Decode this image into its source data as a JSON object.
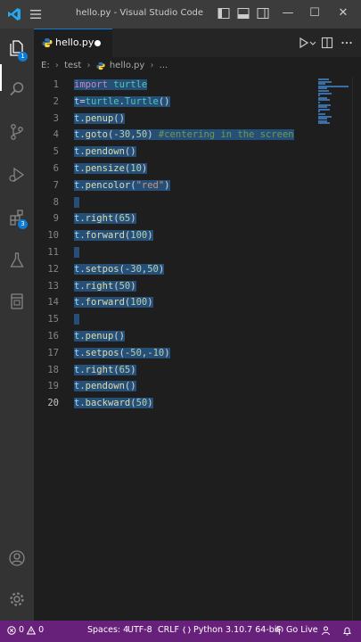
{
  "window": {
    "title": "hello.py - Visual Studio Code",
    "minimize": "—",
    "maximize": "☐",
    "close": "✕"
  },
  "activity": {
    "explorer_badge": "1",
    "extensions_badge": "3"
  },
  "tab": {
    "label": "hello.py"
  },
  "breadcrumb": {
    "drive": "E:",
    "folder": "test",
    "file": "hello.py",
    "more": "..."
  },
  "editor": {
    "active_line": 20,
    "lines": [
      {
        "n": "1",
        "tokens": [
          [
            "k-import",
            "import"
          ],
          [
            "k-pl",
            " "
          ],
          [
            "k-cls",
            "turtle"
          ]
        ]
      },
      {
        "n": "2",
        "tokens": [
          [
            "k-var",
            "t"
          ],
          [
            "k-pl",
            "="
          ],
          [
            "k-cls",
            "turtle"
          ],
          [
            "k-pl",
            "."
          ],
          [
            "k-cls",
            "Turtle"
          ],
          [
            "k-pl",
            "()"
          ]
        ]
      },
      {
        "n": "3",
        "tokens": [
          [
            "k-var",
            "t"
          ],
          [
            "k-pl",
            "."
          ],
          [
            "k-fn",
            "penup"
          ],
          [
            "k-pl",
            "()"
          ]
        ]
      },
      {
        "n": "4",
        "tokens": [
          [
            "k-var",
            "t"
          ],
          [
            "k-pl",
            "."
          ],
          [
            "k-fn",
            "goto"
          ],
          [
            "k-pl",
            "(-"
          ],
          [
            "k-num",
            "30"
          ],
          [
            "k-pl",
            ","
          ],
          [
            "k-num",
            "50"
          ],
          [
            "k-pl",
            ") "
          ],
          [
            "k-cm",
            "#centering in the screen"
          ]
        ]
      },
      {
        "n": "5",
        "tokens": [
          [
            "k-var",
            "t"
          ],
          [
            "k-pl",
            "."
          ],
          [
            "k-fn",
            "pendown"
          ],
          [
            "k-pl",
            "()"
          ]
        ]
      },
      {
        "n": "6",
        "tokens": [
          [
            "k-var",
            "t"
          ],
          [
            "k-pl",
            "."
          ],
          [
            "k-fn",
            "pensize"
          ],
          [
            "k-pl",
            "("
          ],
          [
            "k-num",
            "10"
          ],
          [
            "k-pl",
            ")"
          ]
        ]
      },
      {
        "n": "7",
        "tokens": [
          [
            "k-var",
            "t"
          ],
          [
            "k-pl",
            "."
          ],
          [
            "k-fn",
            "pencolor"
          ],
          [
            "k-pl",
            "("
          ],
          [
            "k-str",
            "\"red\""
          ],
          [
            "k-pl",
            ")"
          ]
        ]
      },
      {
        "n": "8",
        "tokens": []
      },
      {
        "n": "9",
        "tokens": [
          [
            "k-var",
            "t"
          ],
          [
            "k-pl",
            "."
          ],
          [
            "k-fn",
            "right"
          ],
          [
            "k-pl",
            "("
          ],
          [
            "k-num",
            "65"
          ],
          [
            "k-pl",
            ")"
          ]
        ]
      },
      {
        "n": "10",
        "tokens": [
          [
            "k-var",
            "t"
          ],
          [
            "k-pl",
            "."
          ],
          [
            "k-fn",
            "forward"
          ],
          [
            "k-pl",
            "("
          ],
          [
            "k-num",
            "100"
          ],
          [
            "k-pl",
            ")"
          ]
        ]
      },
      {
        "n": "11",
        "tokens": []
      },
      {
        "n": "12",
        "tokens": [
          [
            "k-var",
            "t"
          ],
          [
            "k-pl",
            "."
          ],
          [
            "k-fn",
            "setpos"
          ],
          [
            "k-pl",
            "(-"
          ],
          [
            "k-num",
            "30"
          ],
          [
            "k-pl",
            ","
          ],
          [
            "k-num",
            "50"
          ],
          [
            "k-pl",
            ")"
          ]
        ]
      },
      {
        "n": "13",
        "tokens": [
          [
            "k-var",
            "t"
          ],
          [
            "k-pl",
            "."
          ],
          [
            "k-fn",
            "right"
          ],
          [
            "k-pl",
            "("
          ],
          [
            "k-num",
            "50"
          ],
          [
            "k-pl",
            ")"
          ]
        ]
      },
      {
        "n": "14",
        "tokens": [
          [
            "k-var",
            "t"
          ],
          [
            "k-pl",
            "."
          ],
          [
            "k-fn",
            "forward"
          ],
          [
            "k-pl",
            "("
          ],
          [
            "k-num",
            "100"
          ],
          [
            "k-pl",
            ")"
          ]
        ]
      },
      {
        "n": "15",
        "tokens": []
      },
      {
        "n": "16",
        "tokens": [
          [
            "k-var",
            "t"
          ],
          [
            "k-pl",
            "."
          ],
          [
            "k-fn",
            "penup"
          ],
          [
            "k-pl",
            "()"
          ]
        ]
      },
      {
        "n": "17",
        "tokens": [
          [
            "k-var",
            "t"
          ],
          [
            "k-pl",
            "."
          ],
          [
            "k-fn",
            "setpos"
          ],
          [
            "k-pl",
            "(-"
          ],
          [
            "k-num",
            "50"
          ],
          [
            "k-pl",
            ",-"
          ],
          [
            "k-num",
            "10"
          ],
          [
            "k-pl",
            ")"
          ]
        ]
      },
      {
        "n": "18",
        "tokens": [
          [
            "k-var",
            "t"
          ],
          [
            "k-pl",
            "."
          ],
          [
            "k-fn",
            "right"
          ],
          [
            "k-pl",
            "("
          ],
          [
            "k-num",
            "65"
          ],
          [
            "k-pl",
            ")"
          ]
        ]
      },
      {
        "n": "19",
        "tokens": [
          [
            "k-var",
            "t"
          ],
          [
            "k-pl",
            "."
          ],
          [
            "k-fn",
            "pendown"
          ],
          [
            "k-pl",
            "()"
          ]
        ]
      },
      {
        "n": "20",
        "tokens": [
          [
            "k-var",
            "t"
          ],
          [
            "k-pl",
            "."
          ],
          [
            "k-fn",
            "backward"
          ],
          [
            "k-pl",
            "("
          ],
          [
            "k-num",
            "50"
          ],
          [
            "k-pl",
            ")"
          ]
        ]
      }
    ]
  },
  "status": {
    "errors": "0",
    "warnings": "0",
    "spaces": "Spaces: 4",
    "encoding": "UTF-8",
    "eol": "CRLF",
    "language": "Python",
    "interpreter": "3.10.7 64-bit",
    "golive": "Go Live"
  },
  "colors": {
    "statusbar": "#68217a",
    "selection": "#264f78",
    "accent": "#0a7bd6"
  }
}
